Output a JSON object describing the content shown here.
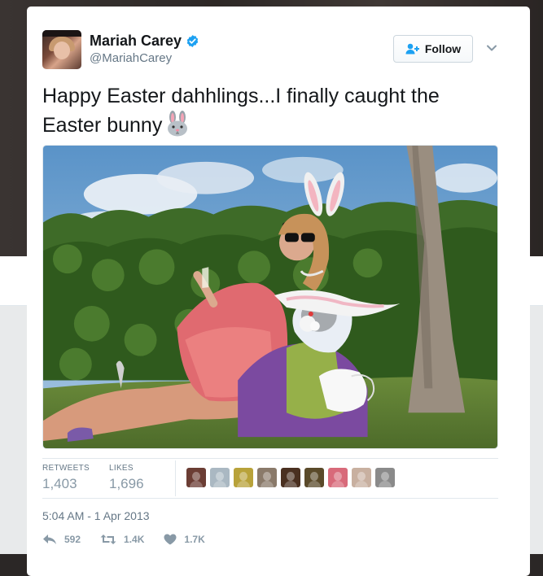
{
  "tweet": {
    "display_name": "Mariah Carey",
    "handle": "@MariahCarey",
    "verified": true,
    "follow_label": "Follow",
    "text": "Happy Easter dahhlings...I finally caught the Easter bunny",
    "emoji": "rabbit-face-emoji",
    "timestamp": "5:04 AM - 1 Apr 2013"
  },
  "stats": {
    "retweets_label": "RETWEETS",
    "retweets_value": "1,403",
    "likes_label": "LIKES",
    "likes_value": "1,696"
  },
  "likers": [
    {
      "name": "liker-avatar-1",
      "color": "#6b3d34"
    },
    {
      "name": "liker-avatar-2",
      "color": "#aab8c2"
    },
    {
      "name": "liker-avatar-3",
      "color": "#b8a23a"
    },
    {
      "name": "liker-avatar-4",
      "color": "#8a7a6a"
    },
    {
      "name": "liker-avatar-5",
      "color": "#4a3020"
    },
    {
      "name": "liker-avatar-6",
      "color": "#5a4a2a"
    },
    {
      "name": "liker-avatar-7",
      "color": "#d86a7a"
    },
    {
      "name": "liker-avatar-8",
      "color": "#c8b0a0"
    },
    {
      "name": "liker-avatar-9",
      "color": "#8a8a8a"
    }
  ],
  "actions": {
    "reply_count": "592",
    "retweet_count": "1.4K",
    "like_count": "1.7K"
  },
  "colors": {
    "verified": "#1da1f2",
    "text_primary": "#14171a",
    "text_secondary": "#657786",
    "action_gray": "#8899a6"
  },
  "icons": [
    "verified-badge-icon",
    "follow-person-icon",
    "chevron-down-icon",
    "reply-icon",
    "retweet-icon",
    "heart-icon"
  ]
}
